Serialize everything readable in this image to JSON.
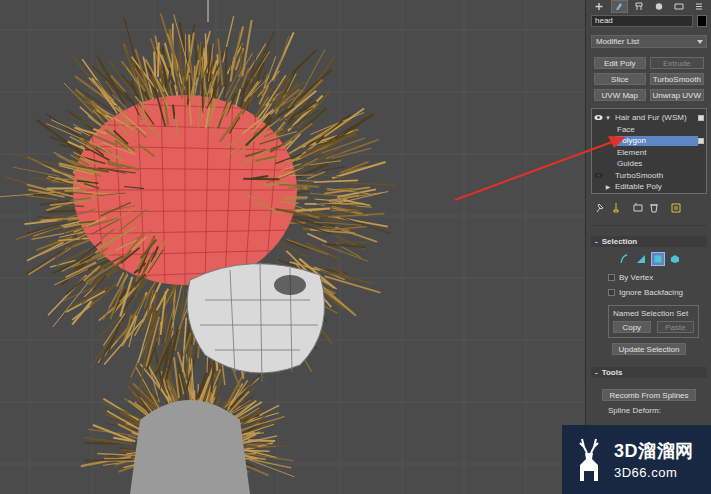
{
  "command_panel": {
    "tabs": [
      {
        "selected": false
      },
      {
        "selected": true
      },
      {
        "selected": false
      },
      {
        "selected": false
      },
      {
        "selected": false
      },
      {
        "selected": false
      }
    ],
    "object_name": "head",
    "object_color": "#000000",
    "modifier_list": "Modifier List",
    "modifier_buttons": [
      {
        "label": "Edit Poly",
        "disabled": false
      },
      {
        "label": "Extrude",
        "disabled": true
      },
      {
        "label": "Slice",
        "disabled": false
      },
      {
        "label": "TurboSmooth",
        "disabled": false
      },
      {
        "label": "UVW Map",
        "disabled": false
      },
      {
        "label": "Unwrap UVW",
        "disabled": false
      }
    ],
    "stack": [
      {
        "label": "Hair and Fur (WSM)",
        "kind": "modifier",
        "toggle": "▼",
        "visible": true,
        "selected": false
      },
      {
        "label": "Face",
        "kind": "sublevel",
        "selected": false
      },
      {
        "label": "Polygon",
        "kind": "sublevel",
        "selected": true
      },
      {
        "label": "Element",
        "kind": "sublevel",
        "selected": false
      },
      {
        "label": "Guides",
        "kind": "sublevel",
        "selected": false
      },
      {
        "label": "TurboSmooth",
        "kind": "modifier",
        "toggle": "",
        "visible": false,
        "selected": false
      },
      {
        "label": "Editable Poly",
        "kind": "base",
        "toggle": "▶",
        "selected": false
      }
    ],
    "selection": {
      "title": "Selection",
      "toggle": "-",
      "modes": [
        {
          "selected": false
        },
        {
          "selected": false
        },
        {
          "selected": true
        },
        {
          "selected": false
        }
      ],
      "checkboxes": [
        {
          "label": "By Vertex",
          "checked": false
        },
        {
          "label": "Ignore Backfacing",
          "checked": false
        }
      ],
      "named_set": {
        "title": "Named Selection Set",
        "buttons": [
          {
            "label": "Copy",
            "disabled": false
          },
          {
            "label": "Paste",
            "disabled": true
          }
        ]
      },
      "update": "Update Selection"
    },
    "tools": {
      "title": "Tools",
      "toggle": "-",
      "button": "Recomb From Splines",
      "label": "Spline Deform:"
    }
  },
  "watermark": {
    "brand": "3D溜溜网",
    "site": "3D66.com"
  }
}
